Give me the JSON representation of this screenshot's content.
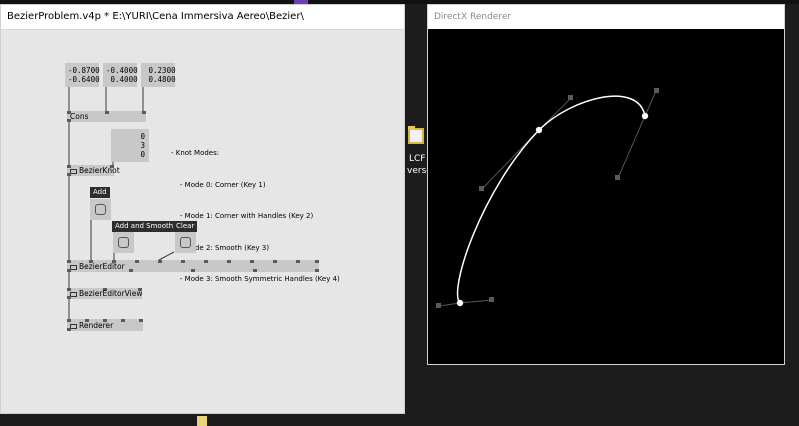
{
  "patch_window": {
    "title": "BezierProblem.v4p *  E:\\YURI\\Cena Immersiva Aereo\\Bezier\\"
  },
  "iobox_values": [
    {
      "lines": [
        "-0.8700",
        "-0.6400"
      ]
    },
    {
      "lines": [
        "-0.4000",
        " 0.4000"
      ]
    },
    {
      "lines": [
        " 0.2300",
        " 0.4800"
      ]
    }
  ],
  "mode_iobox": {
    "lines": [
      "0",
      "3",
      "0"
    ]
  },
  "nodes": {
    "cons": "Cons",
    "bezier_knot": "BezierKnot",
    "bezier_editor": "BezierEditor",
    "bezier_editor_view": "BezierEditorView",
    "renderer": "Renderer"
  },
  "bangs": {
    "add": "Add",
    "add_and_smooth": "Add and Smooth",
    "clear": "Clear"
  },
  "knot_modes_comment": [
    "- Knot Modes:",
    "    - Mode 0: Corner (Key 1)",
    "    - Mode 1: Corner with Handles (Key 2)",
    "    - Mode 2: Smooth (Key 3)",
    "    - Mode 3: Smooth Symmetric Handles (Key 4)"
  ],
  "renderer_window": {
    "title": "DirectX Renderer"
  },
  "desktop": {
    "icon_name": "folder-icon",
    "label_line1": "LCF",
    "label_line2": "verse"
  },
  "colors": {
    "patch_bg": "#e6e6e6",
    "node_bg": "#c8c8c8",
    "render_bg": "#000000",
    "curve": "#ffffff",
    "handle": "#555555"
  }
}
